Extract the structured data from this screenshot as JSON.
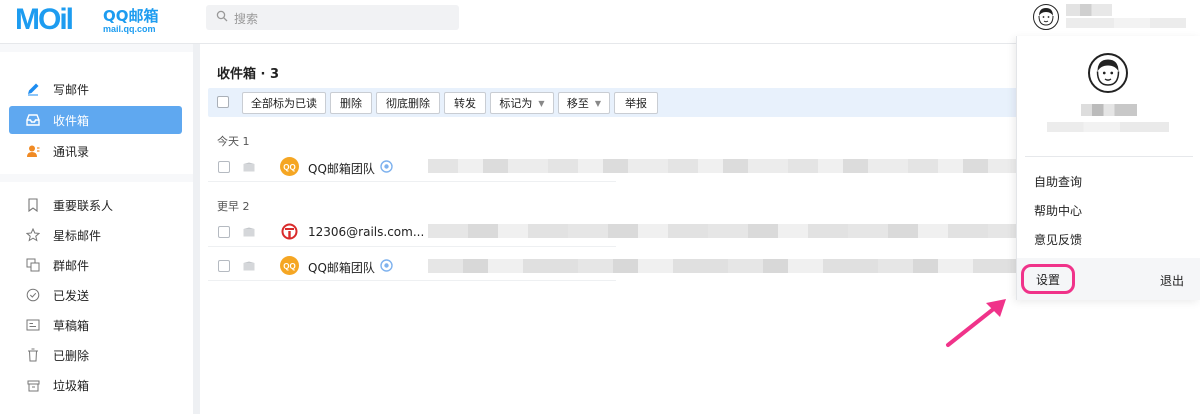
{
  "header": {
    "logo_mark": "MOil",
    "logo_name": "QQ邮箱",
    "logo_domain": "mail.qq.com",
    "search_placeholder": "搜索"
  },
  "sidebar": {
    "compose": "写邮件",
    "inbox": "收件箱",
    "contacts": "通讯录",
    "folders": [
      "重要联系人",
      "星标邮件",
      "群邮件",
      "已发送",
      "草稿箱",
      "已删除",
      "垃圾箱"
    ]
  },
  "main": {
    "title": "收件箱 · 3",
    "toolbar": {
      "mark_all_read": "全部标为已读",
      "delete": "删除",
      "delete_forever": "彻底删除",
      "forward": "转发",
      "mark_as": "标记为",
      "move_to": "移至",
      "report": "举报"
    },
    "sections": [
      {
        "label": "今天 1",
        "rows": [
          {
            "sender": "QQ邮箱团队",
            "icon": "qq-avatar"
          }
        ]
      },
      {
        "label": "更早 2",
        "rows": [
          {
            "sender": "12306@rails.com...",
            "icon": "railway-logo"
          },
          {
            "sender": "QQ邮箱团队",
            "icon": "qq-avatar"
          }
        ]
      }
    ]
  },
  "dropdown": {
    "items": [
      "自助查询",
      "帮助中心",
      "意见反馈"
    ],
    "settings": "设置",
    "logout": "退出"
  },
  "colors": {
    "brand": "#1d9cf0",
    "active_sidebar": "#5fa8f0",
    "toolbar_bg": "#e8f1fc",
    "highlight": "#f0338a"
  }
}
